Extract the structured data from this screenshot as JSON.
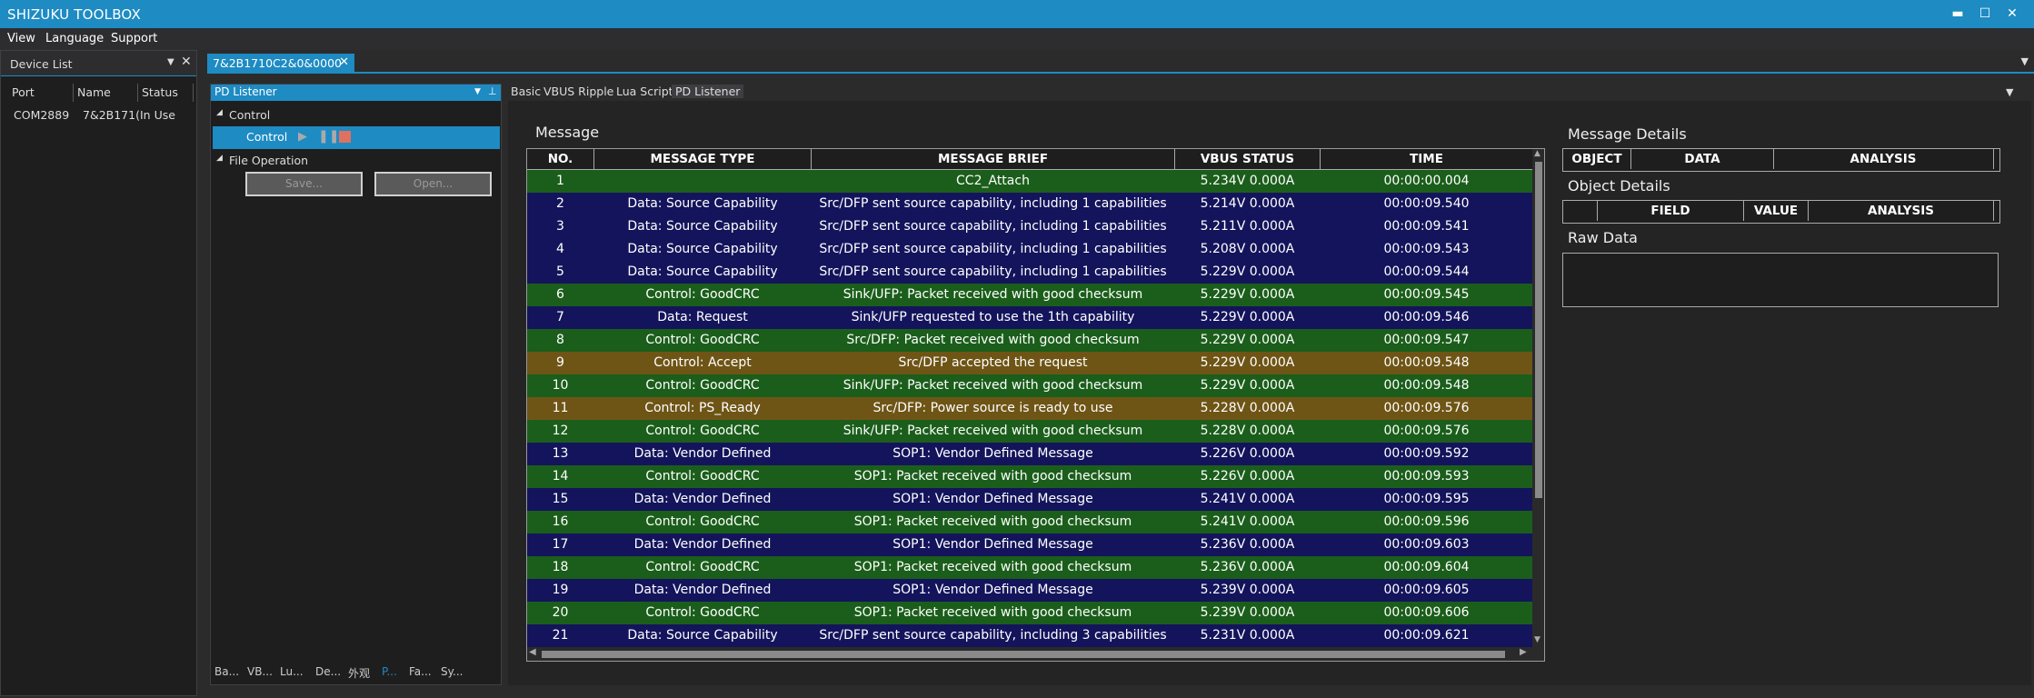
{
  "app": {
    "title": "SHIZUKU TOOLBOX"
  },
  "window_controls": {
    "minimize": "▬",
    "maximize": "☐",
    "close": "✕"
  },
  "menu": [
    "View",
    "Language",
    "Support"
  ],
  "device_list": {
    "title": "Device List",
    "columns": [
      "Port",
      "Name",
      "Status"
    ],
    "rows": [
      {
        "port": "COM2889",
        "name": "7&2B171(",
        "status": "In Use"
      }
    ]
  },
  "document_tab": {
    "label": "7&2B1710C2&0&0000"
  },
  "left_panel": {
    "title": "PD Listener",
    "tree": {
      "control": "Control",
      "control_child": "Control",
      "file_operation": "File Operation"
    },
    "buttons": {
      "save": "Save...",
      "open": "Open..."
    },
    "bottom_tabs": [
      "Ba...",
      "VB...",
      "Lu...",
      "De...",
      "外观",
      "P...",
      "Fa...",
      "Sy..."
    ]
  },
  "sub_tabs": [
    "Basic",
    "VBUS Ripple",
    "Lua Script",
    "PD Listener"
  ],
  "message": {
    "title": "Message",
    "columns": [
      "NO.",
      "MESSAGE TYPE",
      "MESSAGE BRIEF",
      "VBUS STATUS",
      "TIME"
    ],
    "rows": [
      {
        "no": "1",
        "type": "",
        "brief": "CC2_Attach",
        "vbus": "5.234V 0.000A",
        "time": "00:00:00.004",
        "color": "green"
      },
      {
        "no": "2",
        "type": "Data: Source Capability",
        "brief": "Src/DFP sent source capability, including 1 capabilities",
        "vbus": "5.214V 0.000A",
        "time": "00:00:09.540",
        "color": "blue"
      },
      {
        "no": "3",
        "type": "Data: Source Capability",
        "brief": "Src/DFP sent source capability, including 1 capabilities",
        "vbus": "5.211V 0.000A",
        "time": "00:00:09.541",
        "color": "blue"
      },
      {
        "no": "4",
        "type": "Data: Source Capability",
        "brief": "Src/DFP sent source capability, including 1 capabilities",
        "vbus": "5.208V 0.000A",
        "time": "00:00:09.543",
        "color": "blue"
      },
      {
        "no": "5",
        "type": "Data: Source Capability",
        "brief": "Src/DFP sent source capability, including 1 capabilities",
        "vbus": "5.229V 0.000A",
        "time": "00:00:09.544",
        "color": "blue"
      },
      {
        "no": "6",
        "type": "Control: GoodCRC",
        "brief": "Sink/UFP: Packet received with good checksum",
        "vbus": "5.229V 0.000A",
        "time": "00:00:09.545",
        "color": "green"
      },
      {
        "no": "7",
        "type": "Data: Request",
        "brief": "Sink/UFP requested to use the 1th capability",
        "vbus": "5.229V 0.000A",
        "time": "00:00:09.546",
        "color": "blue"
      },
      {
        "no": "8",
        "type": "Control: GoodCRC",
        "brief": "Src/DFP: Packet received with good checksum",
        "vbus": "5.229V 0.000A",
        "time": "00:00:09.547",
        "color": "green"
      },
      {
        "no": "9",
        "type": "Control: Accept",
        "brief": "Src/DFP accepted the request",
        "vbus": "5.229V 0.000A",
        "time": "00:00:09.548",
        "color": "brown"
      },
      {
        "no": "10",
        "type": "Control: GoodCRC",
        "brief": "Sink/UFP: Packet received with good checksum",
        "vbus": "5.229V 0.000A",
        "time": "00:00:09.548",
        "color": "green"
      },
      {
        "no": "11",
        "type": "Control: PS_Ready",
        "brief": "Src/DFP: Power source is ready to use",
        "vbus": "5.228V 0.000A",
        "time": "00:00:09.576",
        "color": "brown"
      },
      {
        "no": "12",
        "type": "Control: GoodCRC",
        "brief": "Sink/UFP: Packet received with good checksum",
        "vbus": "5.228V 0.000A",
        "time": "00:00:09.576",
        "color": "green"
      },
      {
        "no": "13",
        "type": "Data: Vendor Defined",
        "brief": "SOP1: Vendor Defined Message",
        "vbus": "5.226V 0.000A",
        "time": "00:00:09.592",
        "color": "blue"
      },
      {
        "no": "14",
        "type": "Control: GoodCRC",
        "brief": "SOP1: Packet received with good checksum",
        "vbus": "5.226V 0.000A",
        "time": "00:00:09.593",
        "color": "green"
      },
      {
        "no": "15",
        "type": "Data: Vendor Defined",
        "brief": "SOP1: Vendor Defined Message",
        "vbus": "5.241V 0.000A",
        "time": "00:00:09.595",
        "color": "blue"
      },
      {
        "no": "16",
        "type": "Control: GoodCRC",
        "brief": "SOP1: Packet received with good checksum",
        "vbus": "5.241V 0.000A",
        "time": "00:00:09.596",
        "color": "green"
      },
      {
        "no": "17",
        "type": "Data: Vendor Defined",
        "brief": "SOP1: Vendor Defined Message",
        "vbus": "5.236V 0.000A",
        "time": "00:00:09.603",
        "color": "blue"
      },
      {
        "no": "18",
        "type": "Control: GoodCRC",
        "brief": "SOP1: Packet received with good checksum",
        "vbus": "5.236V 0.000A",
        "time": "00:00:09.604",
        "color": "green"
      },
      {
        "no": "19",
        "type": "Data: Vendor Defined",
        "brief": "SOP1: Vendor Defined Message",
        "vbus": "5.239V 0.000A",
        "time": "00:00:09.605",
        "color": "blue"
      },
      {
        "no": "20",
        "type": "Control: GoodCRC",
        "brief": "SOP1: Packet received with good checksum",
        "vbus": "5.239V 0.000A",
        "time": "00:00:09.606",
        "color": "green"
      },
      {
        "no": "21",
        "type": "Data: Source Capability",
        "brief": "Src/DFP sent source capability, including 3 capabilities",
        "vbus": "5.231V 0.000A",
        "time": "00:00:09.621",
        "color": "blue"
      }
    ]
  },
  "message_details": {
    "title": "Message Details",
    "columns": [
      "OBJECT",
      "DATA",
      "ANALYSIS"
    ]
  },
  "object_details": {
    "title": "Object Details",
    "columns": [
      "FIELD",
      "VALUE",
      "ANALYSIS"
    ]
  },
  "raw_data": {
    "title": "Raw Data"
  },
  "colors": {
    "accent": "#1e8bc3",
    "row_green": "#1b5e1b",
    "row_blue": "#14145c",
    "row_brown": "#6e5516"
  }
}
